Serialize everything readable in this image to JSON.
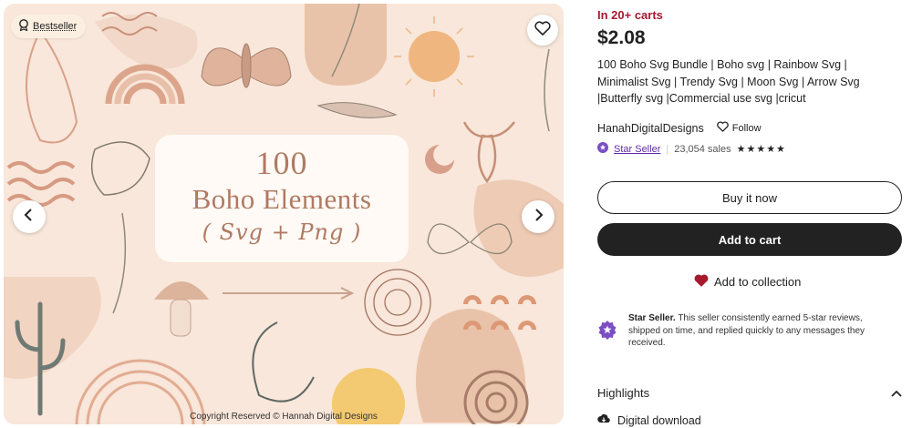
{
  "image": {
    "badge_label": "Bestseller",
    "center_number": "100",
    "center_title": "Boho Elements",
    "center_subtitle": "( Svg + Png )",
    "copyright": "Copyright Reserved © Hannah Digital Designs"
  },
  "product": {
    "in_carts": "In 20+ carts",
    "price": "$2.08",
    "title": "100 Boho Svg Bundle | Boho svg | Rainbow Svg | Minimalist Svg | Trendy Svg | Moon Svg | Arrow Svg |Butterfly svg |Commercial use svg |cricut"
  },
  "shop": {
    "name": "HanahDigitalDesigns",
    "follow_label": "Follow",
    "star_seller_label": "Star Seller",
    "sales": "23,054 sales",
    "stars": "★★★★★"
  },
  "actions": {
    "buy_now": "Buy it now",
    "add_to_cart": "Add to cart",
    "add_to_collection": "Add to collection"
  },
  "star_seller_box": {
    "bold": "Star Seller.",
    "text": "This seller consistently earned 5-star reviews, shipped on time, and replied quickly to any messages they received."
  },
  "highlights": {
    "label": "Highlights",
    "first_item": "Digital download"
  },
  "colors": {
    "accent_red": "#a61a2e",
    "star_seller_purple": "#7b4fc4",
    "heart_red": "#a61a2e",
    "button_dark": "#222222"
  }
}
